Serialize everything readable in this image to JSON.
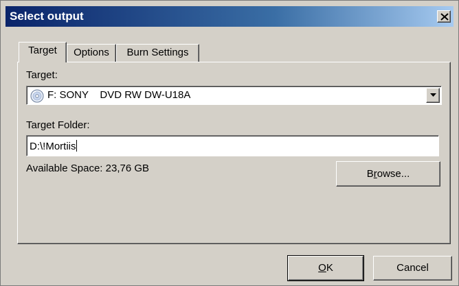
{
  "window": {
    "title": "Select output",
    "close_glyph": "×"
  },
  "tabs": [
    {
      "label": "Target",
      "active": true
    },
    {
      "label": "Options",
      "active": false
    },
    {
      "label": "Burn Settings",
      "active": false
    }
  ],
  "target": {
    "label": "Target:",
    "selected_drive": "F: SONY    DVD RW DW-U18A",
    "drive_icon": "cd-drive-icon"
  },
  "target_folder": {
    "label": "Target Folder:",
    "value": "D:\\!Mortiis"
  },
  "available_space": {
    "text": "Available Space: 23,76 GB"
  },
  "buttons": {
    "browse_prefix": "B",
    "browse_mnemonic": "r",
    "browse_suffix": "owse...",
    "ok_label": "OK",
    "ok_mnemonic": "O",
    "ok_suffix": "K",
    "cancel_label": "Cancel"
  },
  "colors": {
    "titlebar_start": "#0a246a",
    "titlebar_end": "#a6caf0",
    "face": "#d4d0c8"
  }
}
